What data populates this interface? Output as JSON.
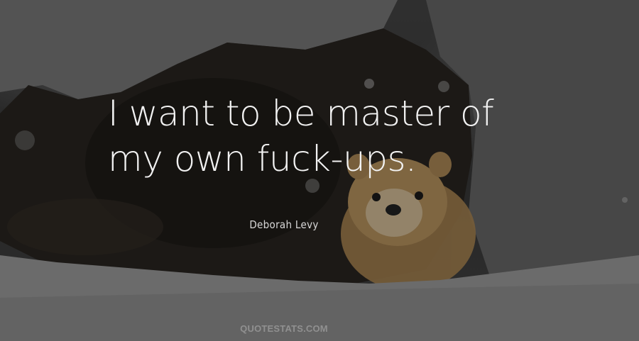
{
  "quote": {
    "line1": "I want to be master of",
    "line2": "my own fuck-ups."
  },
  "author": "Deborah Levy",
  "watermark": "QUOTESTATS.COM",
  "background": {
    "subject": "marten peeking out of a snowy burrow",
    "colors": {
      "snow": "#8a8a8a",
      "burrow": "#1a1612",
      "fur": "#b08a55"
    }
  }
}
